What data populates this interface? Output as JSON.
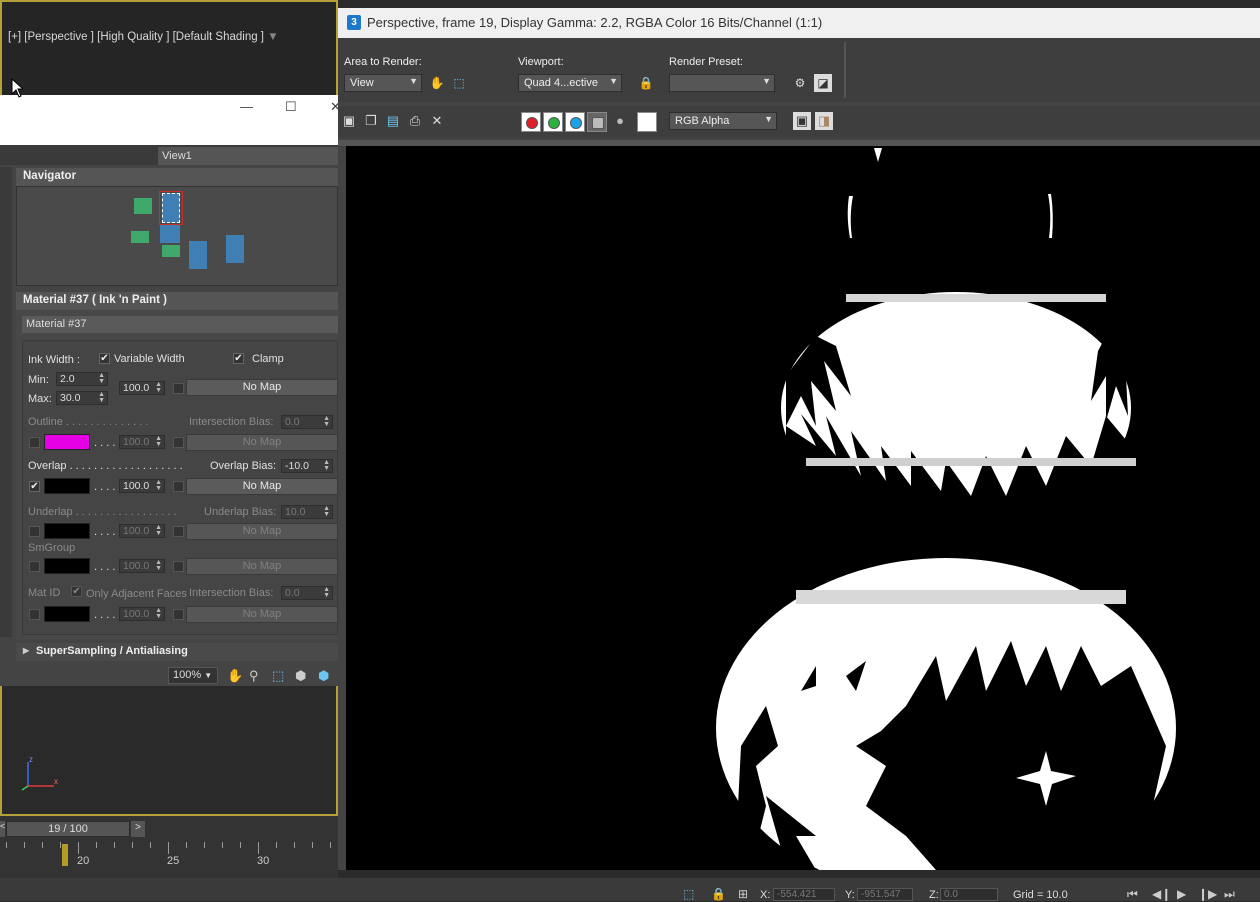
{
  "viewport": {
    "label": "[+] [Perspective ] [High Quality ] [Default Shading ]",
    "filter_icon": "filter-icon",
    "axis_icon": "axis-tripod-icon"
  },
  "slate": {
    "window_controls": {
      "minimize": "—",
      "maximize": "☐",
      "close": "✕"
    },
    "view_tab": "View1",
    "navigator": {
      "title": "Navigator",
      "node_colors": {
        "material": "#3f7fb3",
        "map": "#3fa86a",
        "selected_outline": "#c8312b"
      }
    },
    "material": {
      "title": "Material #37  ( Ink 'n Paint )",
      "name_value": "Material #37",
      "ink_width_label": "Ink Width :",
      "variable_width_label": "Variable Width",
      "clamp_label": "Clamp",
      "min_label": "Min:",
      "min_value": "2.0",
      "max_label": "Max:",
      "max_value": "30.0",
      "ink_map_amount": "100.0",
      "no_map": "No Map",
      "outline": {
        "label": "Outline . . . . . . . . . . . . . .",
        "bias_label": "Intersection Bias:",
        "bias_value": "0.0",
        "amount": "100.0",
        "color": "#e600e6",
        "dots": ". . . ."
      },
      "overlap": {
        "label": "Overlap . . . . . . . . . . . . . . . . . . .",
        "bias_label": "Overlap Bias:",
        "bias_value": "-10.0",
        "amount": "100.0",
        "color": "#000000",
        "dots": ". . . ."
      },
      "underlap": {
        "label": "Underlap . . . . . . . . . . . . . . . . .",
        "bias_label": "Underlap Bias:",
        "bias_value": "10.0",
        "amount": "100.0",
        "color": "#000000",
        "dots": ". . . ."
      },
      "smgroup": {
        "label": "SmGroup",
        "amount": "100.0",
        "color": "#000000",
        "dots": ". . . ."
      },
      "matid": {
        "label": "Mat ID",
        "adjacent_label": "Only Adjacent Faces",
        "bias_label": "Intersection Bias:",
        "bias_value": "0.0",
        "amount": "100.0",
        "color": "#000000",
        "dots": ". . . ."
      }
    },
    "supersampling_title": "SuperSampling / Antialiasing",
    "zoom": "100%"
  },
  "timeline": {
    "frame": "19 / 100",
    "next": ">",
    "prev": "<",
    "tick_labels": [
      "20",
      "25",
      "30"
    ]
  },
  "render": {
    "title": "Perspective, frame 19, Display Gamma: 2.2, RGBA Color 16 Bits/Channel (1:1)",
    "logo": "3",
    "area_label": "Area to Render:",
    "area_value": "View",
    "viewport_label": "Viewport:",
    "viewport_value": "Quad 4...ective",
    "preset_label": "Render Preset:",
    "preset_value": "",
    "channel_value": "RGB Alpha",
    "channel_colors": {
      "red": "#e0202a",
      "green": "#2bb040",
      "blue": "#1aa3e8"
    }
  },
  "status": {
    "x_label": "X:",
    "x_value": "-554.421",
    "y_label": "Y:",
    "y_value": "-951.547",
    "z_label": "Z:",
    "z_value": "0.0",
    "grid": "Grid = 10.0"
  }
}
